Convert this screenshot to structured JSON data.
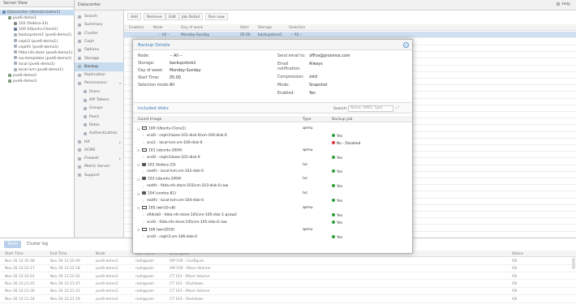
{
  "server_view": {
    "title": "Server View",
    "items": [
      {
        "label": "Datacenter (demohcluster1)",
        "level": 0,
        "selected": true,
        "icon": "datacenter-icon"
      },
      {
        "label": "pve6-demo1",
        "level": 1,
        "icon": "node-icon"
      },
      {
        "label": "102 (fedora-33)",
        "level": 2,
        "icon": "container-icon"
      },
      {
        "label": "100 (Ubuntu-Clone1)",
        "level": 2,
        "icon": "vm-icon"
      },
      {
        "label": "backupstore1 (pve6-demo1)",
        "level": 2,
        "icon": "storage-icon"
      },
      {
        "label": "ceph3 (pve6-demo1)",
        "level": 2,
        "icon": "storage-icon"
      },
      {
        "label": "cephfs (pve6-demo1)",
        "level": 2,
        "icon": "storage-icon"
      },
      {
        "label": "fdda-nfs-store (pve6-demo1)",
        "level": 2,
        "icon": "storage-icon"
      },
      {
        "label": "iso-templates (pve6-demo1)",
        "level": 2,
        "icon": "storage-icon"
      },
      {
        "label": "local (pve6-demo1)",
        "level": 2,
        "icon": "storage-icon"
      },
      {
        "label": "local-lvm (pve6-demo1)",
        "level": 2,
        "icon": "storage-icon"
      },
      {
        "label": "pve6-demo2",
        "level": 1,
        "icon": "node-icon"
      },
      {
        "label": "pve6-demo3",
        "level": 1,
        "icon": "node-icon"
      }
    ]
  },
  "header": {
    "title": "Datacenter",
    "help": "Help"
  },
  "nav": [
    {
      "label": "Search",
      "sub": false,
      "icon": "search-icon"
    },
    {
      "label": "Summary",
      "sub": false,
      "icon": "summary-icon"
    },
    {
      "label": "Cluster",
      "sub": false,
      "icon": "cluster-icon"
    },
    {
      "label": "Ceph",
      "sub": false,
      "icon": "ceph-icon"
    },
    {
      "label": "Options",
      "sub": false,
      "icon": "gear-icon"
    },
    {
      "label": "Storage",
      "sub": false,
      "icon": "storage-icon"
    },
    {
      "label": "Backup",
      "sub": false,
      "active": true,
      "icon": "backup-icon"
    },
    {
      "label": "Replication",
      "sub": false,
      "icon": "replication-icon"
    },
    {
      "label": "Permissions",
      "sub": false,
      "caret": "▾",
      "icon": "lock-icon"
    },
    {
      "label": "Users",
      "sub": true,
      "icon": "user-icon"
    },
    {
      "label": "API Tokens",
      "sub": true,
      "icon": "key-icon"
    },
    {
      "label": "Groups",
      "sub": true,
      "icon": "group-icon"
    },
    {
      "label": "Pools",
      "sub": true,
      "icon": "pool-icon"
    },
    {
      "label": "Roles",
      "sub": true,
      "icon": "role-icon"
    },
    {
      "label": "Authentication",
      "sub": true,
      "icon": "auth-icon"
    },
    {
      "label": "HA",
      "sub": false,
      "caret": "▸",
      "icon": "ha-icon"
    },
    {
      "label": "ACME",
      "sub": false,
      "icon": "certificate-icon"
    },
    {
      "label": "Firewall",
      "sub": false,
      "caret": "▸",
      "icon": "firewall-icon"
    },
    {
      "label": "Metric Server",
      "sub": false,
      "icon": "chart-icon"
    },
    {
      "label": "Support",
      "sub": false,
      "icon": "support-icon"
    }
  ],
  "toolbar": {
    "add": "Add",
    "remove": "Remove",
    "edit": "Edit",
    "job_detail": "Job Detail",
    "run_now": "Run now"
  },
  "backup_grid": {
    "columns": [
      "Enabled",
      "Node",
      "Day of week",
      "Start",
      "Storage",
      "Selection"
    ],
    "rows": [
      {
        "enabled": "",
        "node": "-- All --",
        "day": "Monday-Sunday",
        "start": "05:00",
        "storage": "backupstore1",
        "selection": "-- All --"
      }
    ]
  },
  "modal": {
    "title": "Backup Details",
    "left_fields": [
      {
        "label": "Node:",
        "value": "-- All --"
      },
      {
        "label": "Storage:",
        "value": "backupstore1"
      },
      {
        "label": "Day of week:",
        "value": "Monday-Sunday"
      },
      {
        "label": "Start Time:",
        "value": "05:00"
      },
      {
        "label": "Selection mode:",
        "value": "All"
      }
    ],
    "right_fields": [
      {
        "label": "Send email to:",
        "value": "office@proxmox.com"
      },
      {
        "label": "Email notification:",
        "value": "Always"
      },
      {
        "label": "Compression:",
        "value": "zstd"
      },
      {
        "label": "Mode:",
        "value": "Snapshot"
      },
      {
        "label": "Enabled:",
        "value": "Yes"
      }
    ],
    "included_title": "Included disks",
    "search_label": "Search:",
    "search_placeholder": "Name, VMID, Type",
    "columns": [
      "Guest Image",
      "Type",
      "Backup Job"
    ],
    "rows": [
      {
        "kind": "guest",
        "icon": "vm",
        "label": "100 (Ubuntu-Clone1)",
        "type": "qemu"
      },
      {
        "kind": "disk",
        "label": "scsi0 - ceph3:base-101-disk-0/vm-100-disk-0",
        "job": "Yes",
        "ok": true
      },
      {
        "kind": "disk",
        "label": "scsi1 - local-lvm:vm-100-disk-0",
        "job": "No - Disabled",
        "ok": false
      },
      {
        "kind": "guest",
        "icon": "vm",
        "label": "101 (ubuntu-2004)",
        "type": "qemu"
      },
      {
        "kind": "disk",
        "label": "scsi0 - ceph3:base-101-disk-0",
        "job": "Yes",
        "ok": true
      },
      {
        "kind": "guest",
        "icon": "ct",
        "label": "102 (fedora-33)",
        "type": "lxc"
      },
      {
        "kind": "disk",
        "label": "rootfs - local-lvm:vm-102-disk-0",
        "job": "Yes",
        "ok": true
      },
      {
        "kind": "guest",
        "icon": "ct",
        "label": "103 (ubuntu-2004)",
        "type": "lxc"
      },
      {
        "kind": "disk",
        "label": "rootfs - fdda-nfs-store:103/vm-103-disk-0.raw",
        "job": "Yes",
        "ok": true
      },
      {
        "kind": "guest",
        "icon": "ct",
        "label": "104 (centos-81)",
        "type": "lxc"
      },
      {
        "kind": "disk",
        "label": "rootfs - local-lvm:vm-104-disk-0",
        "job": "Yes",
        "ok": true
      },
      {
        "kind": "guest",
        "icon": "vm",
        "label": "105 (win10-v8)",
        "type": "qemu"
      },
      {
        "kind": "disk",
        "label": "efidisk0 - fdda-nfs-store:105/vm-105-disk-1.qcow2",
        "job": "Yes",
        "ok": true
      },
      {
        "kind": "disk",
        "label": "scsi0 - fdda-nfs-store:105/vm-105-disk-0.raw",
        "job": "Yes",
        "ok": true
      },
      {
        "kind": "guest",
        "icon": "vm",
        "label": "106 (win2019)",
        "type": "qemu"
      },
      {
        "kind": "disk",
        "label": "scsi0 - ceph3:vm-106-disk-0",
        "job": "Yes",
        "ok": true
      }
    ]
  },
  "log": {
    "tabs": [
      "Tasks",
      "Cluster log"
    ],
    "columns": [
      "Start Time",
      "End Time",
      "Node",
      "User name",
      "Description",
      "Status"
    ],
    "rows": [
      {
        "start": "Nov 26 12:35:48",
        "end": "Nov 26 12:35:49",
        "node": "pve6-demo1",
        "user": "root@pam",
        "desc": "VM 100 - Configure",
        "status": "OK"
      },
      {
        "start": "Nov 26 12:22:17",
        "end": "Nov 26 12:22:18",
        "node": "pve6-demo1",
        "user": "root@pam",
        "desc": "VM 100 - Move Volume",
        "status": "OK"
      },
      {
        "start": "Nov 26 12:22:01",
        "end": "Nov 26 12:22:02",
        "node": "pve6-demo1",
        "user": "root@pam",
        "desc": "CT 102 - Move Volume",
        "status": "OK"
      },
      {
        "start": "Nov 26 12:21:45",
        "end": "Nov 26 12:21:47",
        "node": "pve6-demo1",
        "user": "root@pam",
        "desc": "CT 102 - Shutdown",
        "status": "OK"
      },
      {
        "start": "Nov 26 12:21:30",
        "end": "Nov 26 12:21:31",
        "node": "pve6-demo1",
        "user": "root@pam",
        "desc": "CT 103 - Move Volume",
        "status": "OK"
      },
      {
        "start": "Nov 26 12:21:18",
        "end": "Nov 26 12:21:19",
        "node": "pve6-demo1",
        "user": "root@pam",
        "desc": "CT 103 - Shutdown",
        "status": "OK"
      }
    ]
  }
}
